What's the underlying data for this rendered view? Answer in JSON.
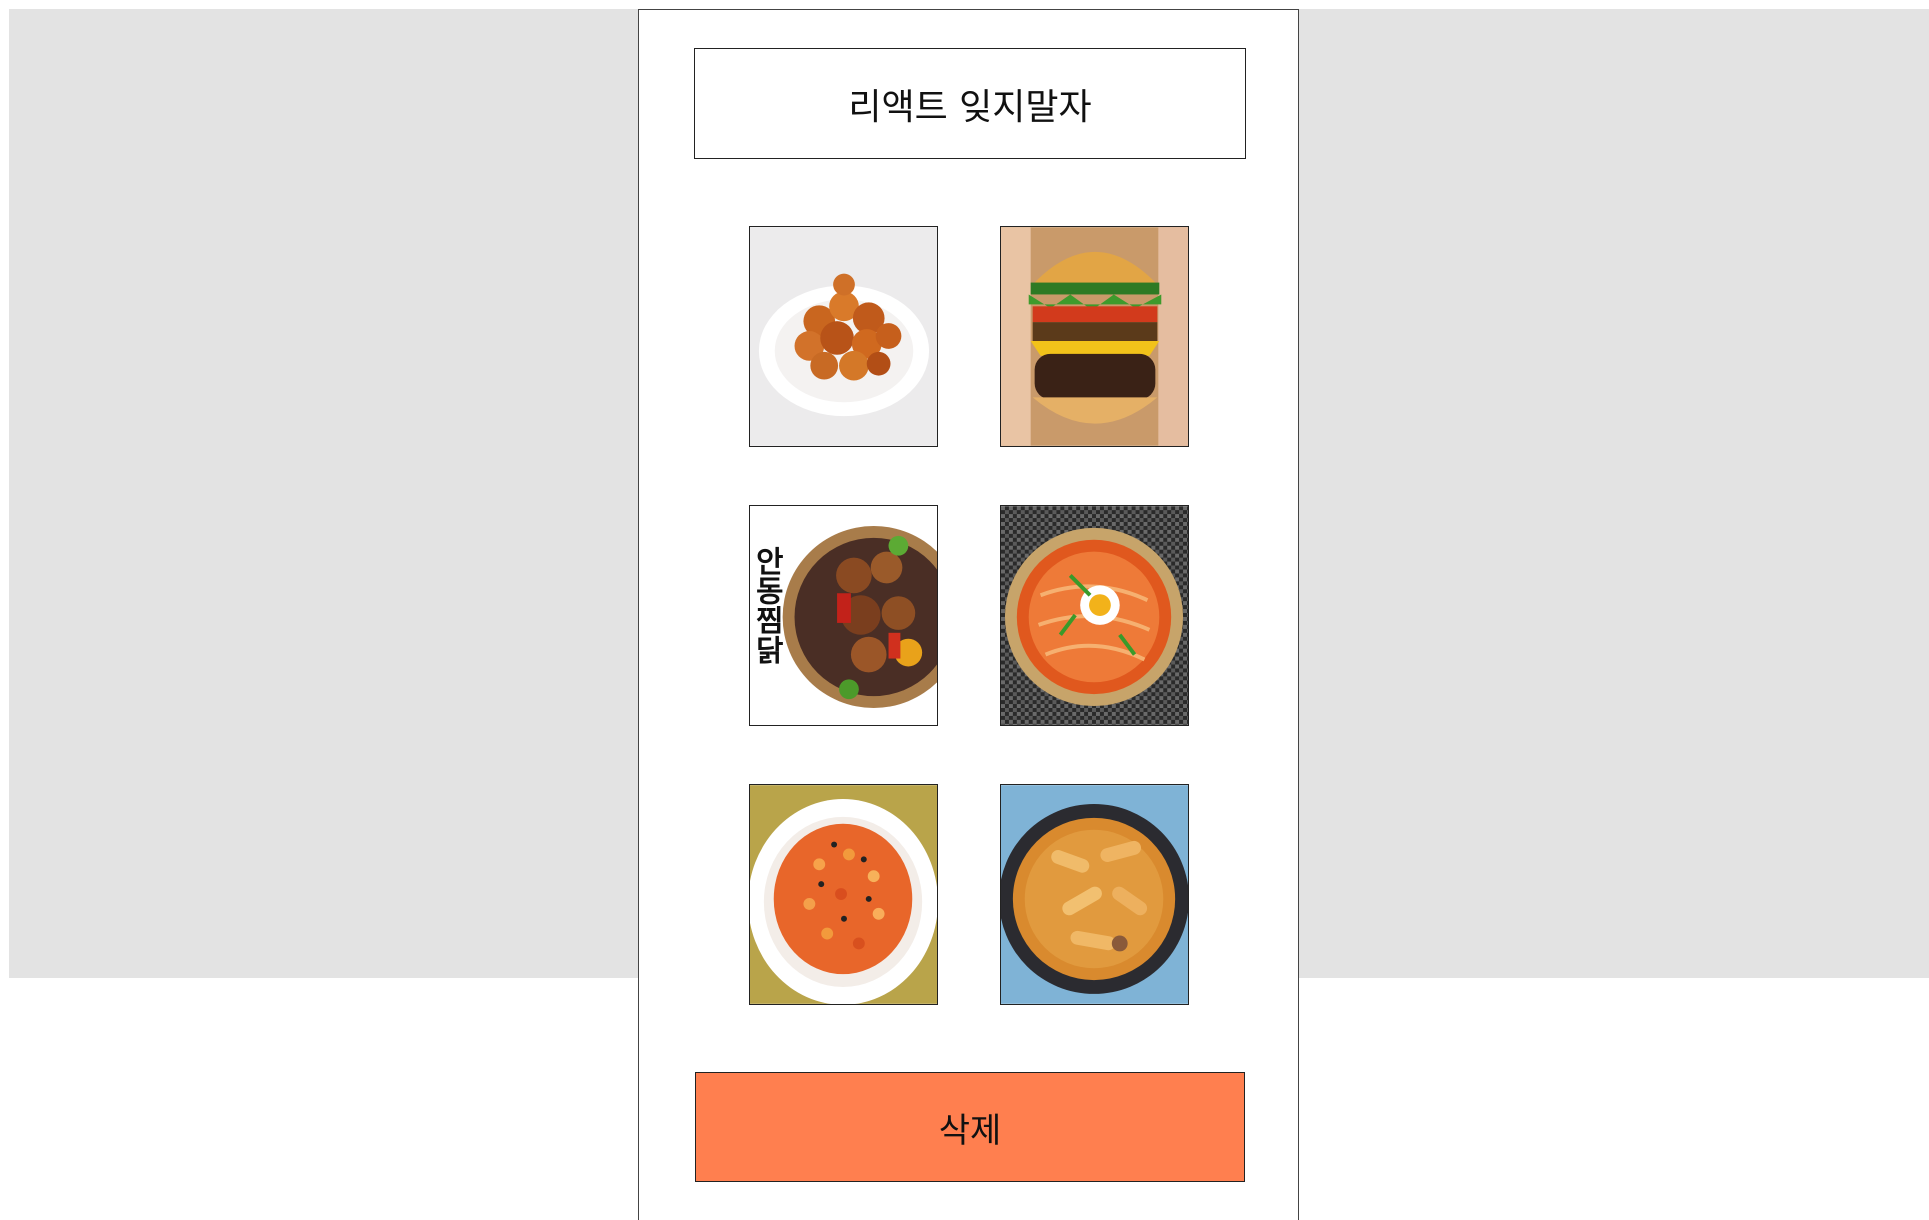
{
  "header": {
    "title": "리액트 잊지말자"
  },
  "foods": [
    {
      "name": "fried-chicken",
      "vertical_text": ""
    },
    {
      "name": "burger",
      "vertical_text": ""
    },
    {
      "name": "jjimdak",
      "vertical_text": "안동찜닭"
    },
    {
      "name": "ramen",
      "vertical_text": ""
    },
    {
      "name": "fried-rice",
      "vertical_text": ""
    },
    {
      "name": "tteokbokki",
      "vertical_text": ""
    }
  ],
  "actions": {
    "delete_label": "삭제"
  },
  "colors": {
    "delete_button": "#ff7f4f",
    "background_band": "#e3e3e3",
    "panel": "#ffffff"
  }
}
